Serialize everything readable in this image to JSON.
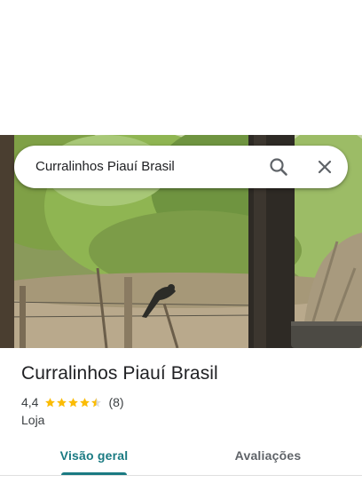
{
  "search": {
    "query": "Curralinhos Piauí Brasil"
  },
  "colors": {
    "accent": "#1a7a82",
    "star": "#fbbc04",
    "text": "#202124",
    "muted": "#5f6368"
  },
  "place": {
    "title": "Curralinhos Piauí Brasil",
    "rating": "4,4",
    "rating_value": 4.4,
    "reviews": "(8)",
    "category": "Loja"
  },
  "tabs": [
    {
      "label": "Visão geral",
      "selected": true
    },
    {
      "label": "Avaliações",
      "selected": false
    }
  ],
  "icons": {
    "search": "search-icon",
    "close": "close-icon",
    "star": "star-icon"
  }
}
